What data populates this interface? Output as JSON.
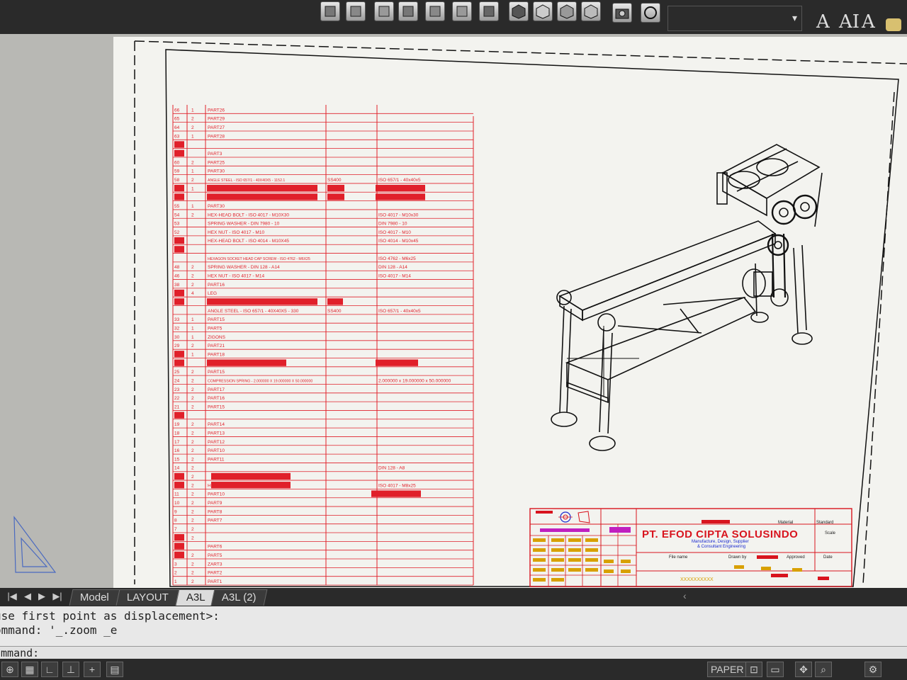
{
  "toolbar": {
    "text_buttons": [
      "A",
      "AI",
      "A"
    ]
  },
  "layout_tabs": [
    "Model",
    "LAYOUT",
    "A3L",
    "A3L (2)"
  ],
  "active_tab": "A3L",
  "command_history": [
    "use first point as displacement>:",
    "ommand: '_.zoom _e"
  ],
  "command_prompt": "ommand:",
  "status": {
    "paper_label": "PAPER"
  },
  "title_block": {
    "company": "PT. EFOD CIPTA SOLUSINDO",
    "tagline_1": "Manufacture, Design, Supplier",
    "tagline_2": "& Consultant Engineering",
    "file_name_label": "File name",
    "drawn_by_label": "Drawn by",
    "approved_label": "Approved",
    "date_label": "Date",
    "material_label": "Material",
    "standard_label": "Standard",
    "scale_label": "Scale",
    "drawing_number": "XXXXXXXXXX"
  },
  "bom": {
    "rows": [
      {
        "no": "66",
        "qty": "1",
        "desc": "PART26",
        "std": "",
        "mat": ""
      },
      {
        "no": "65",
        "qty": "2",
        "desc": "PART29",
        "std": "",
        "mat": ""
      },
      {
        "no": "64",
        "qty": "2",
        "desc": "PART27",
        "std": "",
        "mat": ""
      },
      {
        "no": "63",
        "qty": "1",
        "desc": "PART28",
        "std": "",
        "mat": ""
      },
      {
        "no": "",
        "qty": "",
        "desc": "",
        "std": "",
        "mat": ""
      },
      {
        "no": "",
        "qty": "",
        "desc": "PART3",
        "std": "",
        "mat": ""
      },
      {
        "no": "60",
        "qty": "2",
        "desc": "PART25",
        "std": "",
        "mat": ""
      },
      {
        "no": "59",
        "qty": "1",
        "desc": "PART30",
        "std": "",
        "mat": ""
      },
      {
        "no": "58",
        "qty": "2",
        "desc": "ANGLE STEEL - ISO 657/1 - 40X40X5 - 1152.1",
        "std": "SS400",
        "mat": "ISO 657/1 - 40x40x5"
      },
      {
        "no": "57",
        "qty": "1",
        "desc": "",
        "std": "",
        "mat": ""
      },
      {
        "no": "",
        "qty": "",
        "desc": "",
        "std": "",
        "mat": ""
      },
      {
        "no": "55",
        "qty": "1",
        "desc": "PART30",
        "std": "",
        "mat": ""
      },
      {
        "no": "54",
        "qty": "2",
        "desc": "HEX-HEAD BOLT - ISO 4017 - M10X30",
        "std": "",
        "mat": "ISO 4017 - M10x30"
      },
      {
        "no": "53",
        "qty": "",
        "desc": "SPRING WASHER - DIN 7980 - 10",
        "std": "",
        "mat": "DIN 7980 - 10"
      },
      {
        "no": "52",
        "qty": "",
        "desc": "HEX NUT - ISO 4017 - M10",
        "std": "",
        "mat": "ISO 4017 - M10"
      },
      {
        "no": "51",
        "qty": "",
        "desc": "HEX-HEAD BOLT - ISO 4014 - M10X45",
        "std": "",
        "mat": "ISO 4014 - M10x45"
      },
      {
        "no": "",
        "qty": "",
        "desc": "",
        "std": "",
        "mat": ""
      },
      {
        "no": "",
        "qty": "",
        "desc": "HEXAGON SOCKET HEAD CAP SCREW - ISO 4762 - M6X25",
        "std": "",
        "mat": "ISO 4762 - M6x25"
      },
      {
        "no": "48",
        "qty": "2",
        "desc": "SPRING WASHER - DIN 128 - A14",
        "std": "",
        "mat": "DIN 128 - A14"
      },
      {
        "no": "46",
        "qty": "2",
        "desc": "HEX NUT - ISO 4017 - M14",
        "std": "",
        "mat": "ISO 4017 - M14"
      },
      {
        "no": "38",
        "qty": "2",
        "desc": "PART16",
        "std": "",
        "mat": ""
      },
      {
        "no": "37",
        "qty": "4",
        "desc": "LEG",
        "std": "",
        "mat": ""
      },
      {
        "no": "",
        "qty": "",
        "desc": "",
        "std": "",
        "mat": ""
      },
      {
        "no": "",
        "qty": "",
        "desc": "ANGLE STEEL - ISO 657/1 - 40X40X5 - 330",
        "std": "SS400",
        "mat": "ISO 657/1 - 40x40x5"
      },
      {
        "no": "33",
        "qty": "1",
        "desc": "PART15",
        "std": "",
        "mat": ""
      },
      {
        "no": "32",
        "qty": "1",
        "desc": "PART5",
        "std": "",
        "mat": ""
      },
      {
        "no": "30",
        "qty": "1",
        "desc": "ZIGONS",
        "std": "",
        "mat": ""
      },
      {
        "no": "29",
        "qty": "2",
        "desc": "PART21",
        "std": "",
        "mat": ""
      },
      {
        "no": "27",
        "qty": "1",
        "desc": "PART18",
        "std": "",
        "mat": ""
      },
      {
        "no": "",
        "qty": "",
        "desc": "",
        "std": "",
        "mat": ""
      },
      {
        "no": "25",
        "qty": "2",
        "desc": "PART15",
        "std": "",
        "mat": ""
      },
      {
        "no": "24",
        "qty": "2",
        "desc": "COMPRESSION SPRING - 2.000000 X 19.000000 X 50.000000",
        "std": "",
        "mat": "2.000000 x 19.000000 x 50.000000"
      },
      {
        "no": "23",
        "qty": "2",
        "desc": "PART17",
        "std": "",
        "mat": ""
      },
      {
        "no": "22",
        "qty": "2",
        "desc": "PART16",
        "std": "",
        "mat": ""
      },
      {
        "no": "21",
        "qty": "2",
        "desc": "PART15",
        "std": "",
        "mat": ""
      },
      {
        "no": "",
        "qty": "",
        "desc": "",
        "std": "",
        "mat": ""
      },
      {
        "no": "19",
        "qty": "2",
        "desc": "PART14",
        "std": "",
        "mat": ""
      },
      {
        "no": "18",
        "qty": "2",
        "desc": "PART13",
        "std": "",
        "mat": ""
      },
      {
        "no": "17",
        "qty": "2",
        "desc": "PART12",
        "std": "",
        "mat": ""
      },
      {
        "no": "16",
        "qty": "2",
        "desc": "PART10",
        "std": "",
        "mat": ""
      },
      {
        "no": "15",
        "qty": "2",
        "desc": "PART11",
        "std": "",
        "mat": ""
      },
      {
        "no": "14",
        "qty": "2",
        "desc": "",
        "std": "",
        "mat": "DIN 128 - A8"
      },
      {
        "no": "13",
        "qty": "2",
        "desc": "",
        "std": "",
        "mat": ""
      },
      {
        "no": "12",
        "qty": "2",
        "desc": "HEX-HEAD BOLT - ISO 4017 - M8X25",
        "std": "",
        "mat": "ISO 4017 - M8x25"
      },
      {
        "no": "11",
        "qty": "2",
        "desc": "PART10",
        "std": "",
        "mat": ""
      },
      {
        "no": "10",
        "qty": "2",
        "desc": "PART9",
        "std": "",
        "mat": ""
      },
      {
        "no": "9",
        "qty": "2",
        "desc": "PART8",
        "std": "",
        "mat": ""
      },
      {
        "no": "8",
        "qty": "2",
        "desc": "PART7",
        "std": "",
        "mat": ""
      },
      {
        "no": "7",
        "qty": "2",
        "desc": "",
        "std": "",
        "mat": ""
      },
      {
        "no": "6",
        "qty": "2",
        "desc": "",
        "std": "",
        "mat": ""
      },
      {
        "no": "",
        "qty": "",
        "desc": "PART6",
        "std": "",
        "mat": ""
      },
      {
        "no": "4",
        "qty": "2",
        "desc": "PART5",
        "std": "",
        "mat": ""
      },
      {
        "no": "3",
        "qty": "2",
        "desc": "ZART3",
        "std": "",
        "mat": ""
      },
      {
        "no": "2",
        "qty": "2",
        "desc": "PART2",
        "std": "",
        "mat": ""
      },
      {
        "no": "1",
        "qty": "2",
        "desc": "PART1",
        "std": "",
        "mat": ""
      }
    ]
  },
  "colors": {
    "bom_red": "#e0202a",
    "title_red": "#d8141e",
    "title_blue": "#1a2ad0",
    "title_magenta": "#c020c0",
    "title_yellow": "#d8a000",
    "paper": "#f3f3ef"
  }
}
